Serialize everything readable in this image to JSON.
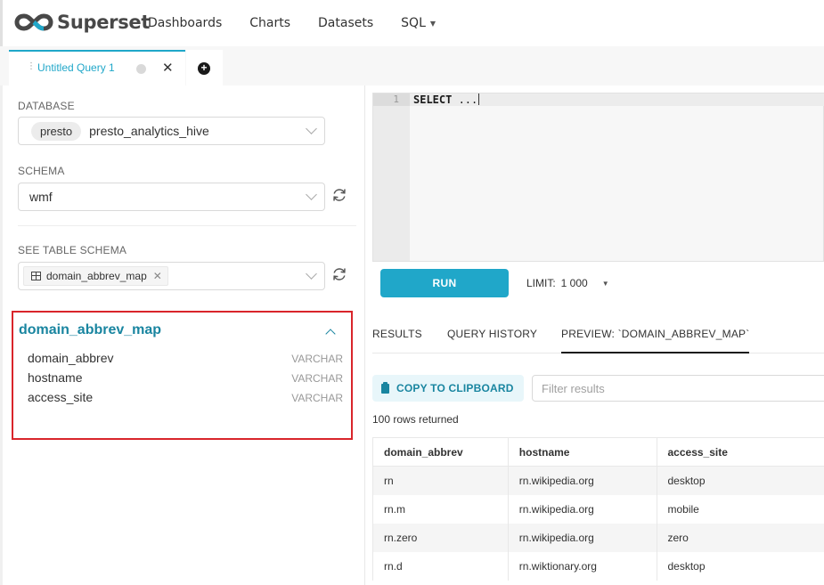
{
  "navbar": {
    "brand": "Superset",
    "items": [
      {
        "label": "Dashboards"
      },
      {
        "label": "Charts"
      },
      {
        "label": "Datasets"
      },
      {
        "label": "SQL",
        "has_dropdown": true
      }
    ],
    "icons": {
      "logo": "superset-infinity-logo",
      "dropdown": "caret-down-icon"
    }
  },
  "tabs": {
    "active_tab": {
      "title": "Untitled Query 1",
      "status": "idle"
    },
    "icons": {
      "drag": "drag-handle-icon",
      "close": "close-icon",
      "new": "plus-circle-icon"
    }
  },
  "left_panel": {
    "database": {
      "label": "DATABASE",
      "engine_tag": "presto",
      "value": "presto_analytics_hive"
    },
    "schema": {
      "label": "SCHEMA",
      "value": "wmf"
    },
    "table_schema": {
      "label": "SEE TABLE SCHEMA",
      "selected_table": "domain_abbrev_map"
    },
    "table_preview": {
      "table_name": "domain_abbrev_map",
      "columns": [
        {
          "name": "domain_abbrev",
          "type": "VARCHAR"
        },
        {
          "name": "hostname",
          "type": "VARCHAR"
        },
        {
          "name": "access_site",
          "type": "VARCHAR"
        }
      ]
    }
  },
  "editor": {
    "line_number": "1",
    "code_keyword": "SELECT",
    "code_rest": " ..."
  },
  "toolbar": {
    "run_label": "RUN",
    "limit_label": "LIMIT:",
    "limit_value": "1 000"
  },
  "result_tabs": [
    {
      "label": "RESULTS",
      "active": false
    },
    {
      "label": "QUERY HISTORY",
      "active": false
    },
    {
      "label": "PREVIEW: `DOMAIN_ABBREV_MAP`",
      "active": true
    }
  ],
  "results": {
    "copy_label": "COPY TO CLIPBOARD",
    "filter_placeholder": "Filter results",
    "rows_returned": "100 rows returned",
    "columns": [
      "domain_abbrev",
      "hostname",
      "access_site"
    ],
    "rows": [
      [
        "rn",
        "rn.wikipedia.org",
        "desktop"
      ],
      [
        "rn.m",
        "rn.wikipedia.org",
        "mobile"
      ],
      [
        "rn.zero",
        "rn.wikipedia.org",
        "zero"
      ],
      [
        "rn.d",
        "rn.wiktionary.org",
        "desktop"
      ]
    ]
  },
  "colors": {
    "accent": "#20a7c9",
    "accent_dark": "#1985a0",
    "highlight_border": "#d9252b"
  }
}
